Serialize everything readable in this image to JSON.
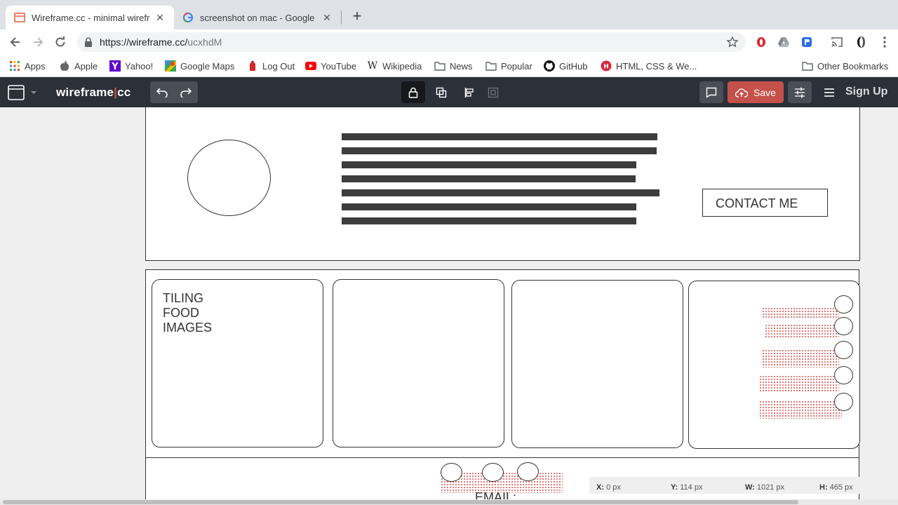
{
  "tabs": [
    {
      "title": "Wireframe.cc - minimal wirefra",
      "active": true,
      "favicon": "wireframe-favicon"
    },
    {
      "title": "screenshot on mac - Google Se",
      "active": false,
      "favicon": "google-favicon"
    }
  ],
  "address": {
    "host": "https://wireframe.cc/",
    "path": "ucxhdM"
  },
  "bookmarks": [
    {
      "label": "Apps",
      "icon": "apps-grid-icon"
    },
    {
      "label": "Apple",
      "icon": "apple-icon"
    },
    {
      "label": "Yahoo!",
      "icon": "yahoo-icon"
    },
    {
      "label": "Google Maps",
      "icon": "maps-icon"
    },
    {
      "label": "Log Out",
      "icon": "logout-icon"
    },
    {
      "label": "YouTube",
      "icon": "youtube-icon"
    },
    {
      "label": "Wikipedia",
      "icon": "wikipedia-icon"
    },
    {
      "label": "News",
      "icon": "folder-icon"
    },
    {
      "label": "Popular",
      "icon": "folder-icon"
    },
    {
      "label": "GitHub",
      "icon": "github-icon"
    },
    {
      "label": "HTML, CSS & We...",
      "icon": "html5-icon"
    }
  ],
  "other_bookmarks": "Other Bookmarks",
  "app": {
    "logo_left": "wireframe",
    "logo_sep": "|",
    "logo_right": "cc",
    "save_label": "Save",
    "signup_label": "Sign Up"
  },
  "wireframe": {
    "contact_label": "CONTACT ME",
    "tiling_lines": [
      "TILING",
      "FOOD",
      "IMAGES"
    ],
    "email_label": "EMAIL:"
  },
  "status": {
    "x_label": "X:",
    "x_value": "0 px",
    "y_label": "Y:",
    "y_value": "114 px",
    "w_label": "W:",
    "w_value": "1021 px",
    "h_label": "H:",
    "h_value": "465 px"
  },
  "colors": {
    "appbar": "#2c3038",
    "save": "#c4524a",
    "accent_dots": "#d9534f"
  }
}
